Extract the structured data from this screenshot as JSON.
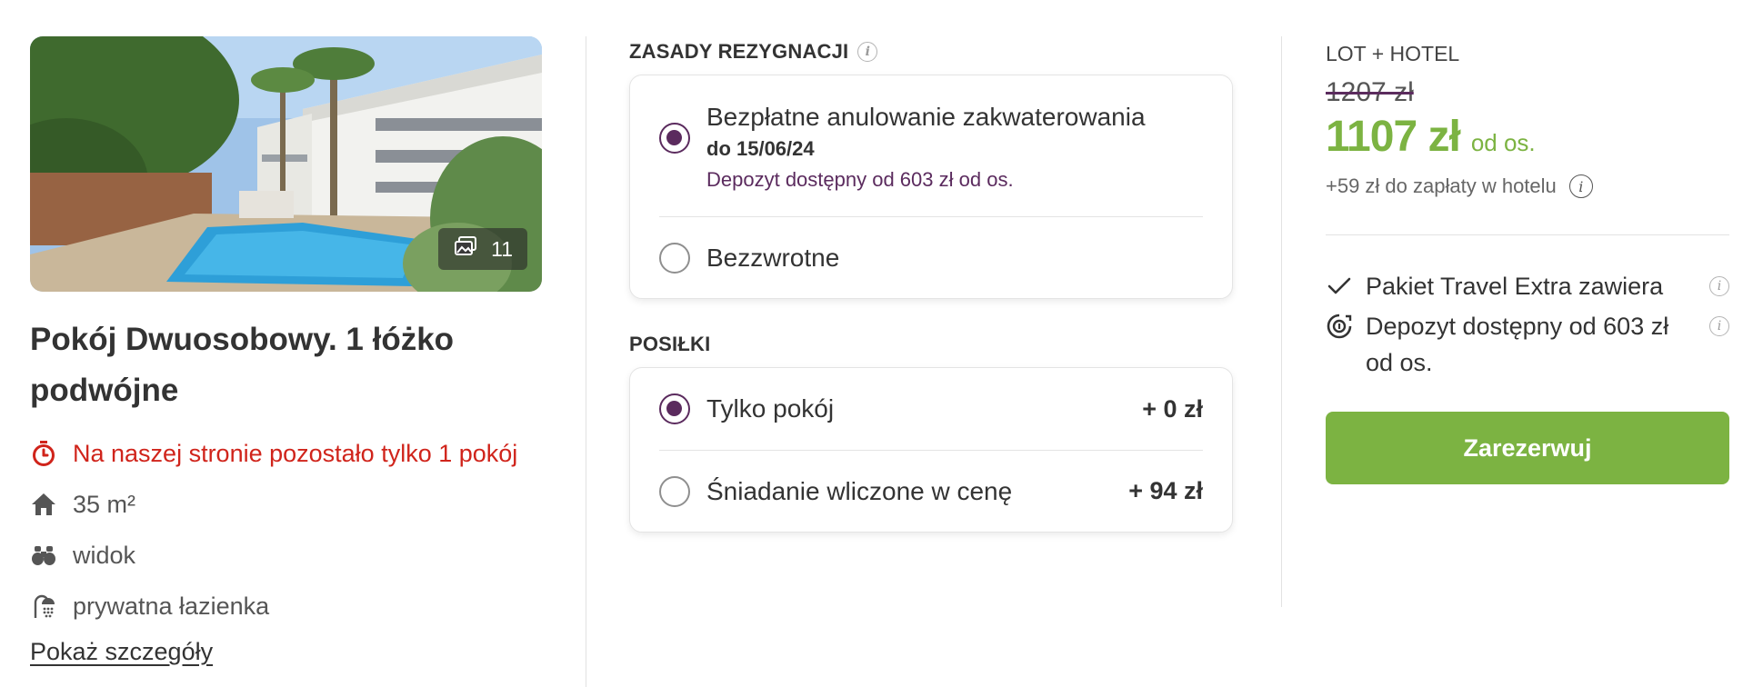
{
  "room": {
    "photo_count": "11",
    "title": "Pokój Dwuosobowy. 1 łóżko podwójne",
    "availability_alert": "Na naszej stronie pozostało tylko 1 pokój",
    "features": [
      {
        "icon": "home-icon",
        "label": "35 m²"
      },
      {
        "icon": "binoculars-icon",
        "label": "widok"
      },
      {
        "icon": "shower-icon",
        "label": "prywatna łazienka"
      }
    ],
    "details_link": "Pokaż szczegóły"
  },
  "cancellation": {
    "heading": "ZASADY REZYGNACJI",
    "options": [
      {
        "label": "Bezpłatne anulowanie zakwaterowania",
        "date": "do 15/06/24",
        "deposit": "Depozyt dostępny od 603 zł od os.",
        "selected": true
      },
      {
        "label": "Bezzwrotne",
        "selected": false
      }
    ]
  },
  "meals": {
    "heading": "POSIŁKI",
    "options": [
      {
        "label": "Tylko pokój",
        "price": "+ 0 zł",
        "selected": true
      },
      {
        "label": "Śniadanie wliczone w cenę",
        "price": "+ 94 zł",
        "selected": false
      }
    ]
  },
  "pricing": {
    "package_label": "LOT + HOTEL",
    "old_price": "1207 zł",
    "price": "1107 zł",
    "price_unit": "od os.",
    "extra_pay": "+59 zł do zapłaty w hotelu",
    "perks": [
      {
        "icon": "checkmark-icon",
        "label": "Pakiet Travel Extra zawiera"
      },
      {
        "icon": "deposit-icon",
        "label": "Depozyt dostępny od 603 zł od os."
      }
    ],
    "book_button": "Zarezerwuj"
  },
  "colors": {
    "brand_purple": "#5b2b5e",
    "price_green": "#7cb342",
    "alert_red": "#d0241b"
  }
}
